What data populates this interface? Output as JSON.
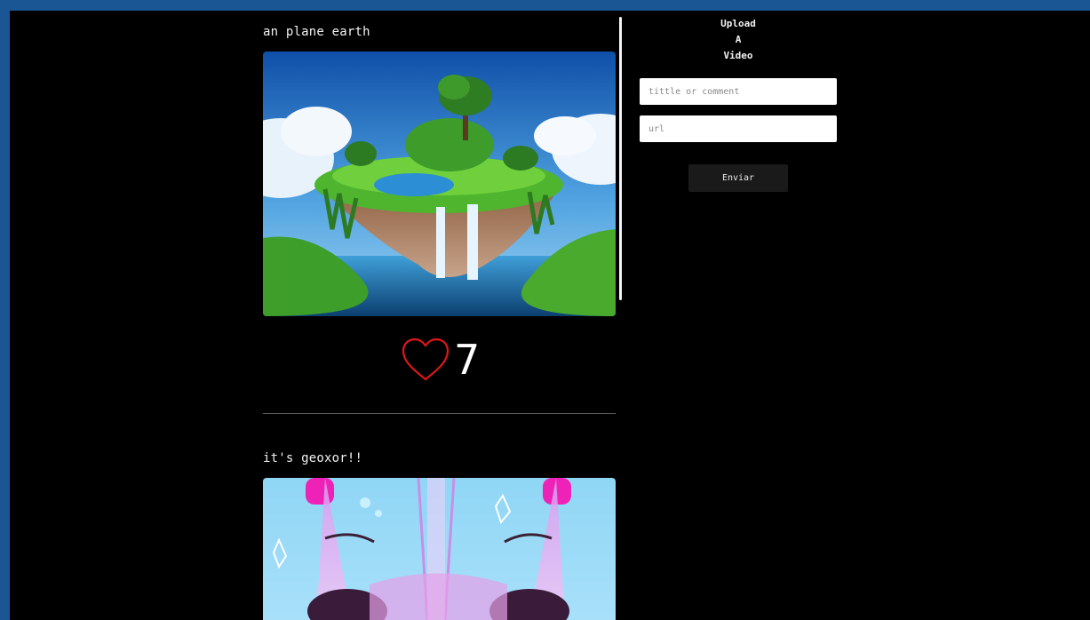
{
  "upload": {
    "title_line1": "Upload",
    "title_line2": "A",
    "title_line3": "Video",
    "title_placeholder": "tittle or comment",
    "url_placeholder": "url",
    "submit_label": "Enviar"
  },
  "posts": [
    {
      "title": "an plane earth",
      "likes": "7",
      "icon": "heart-icon"
    },
    {
      "title": "it's geoxor!!"
    }
  ],
  "colors": {
    "outer_background": "#1b5694",
    "page_background": "#000000",
    "heart": "#e01818"
  }
}
